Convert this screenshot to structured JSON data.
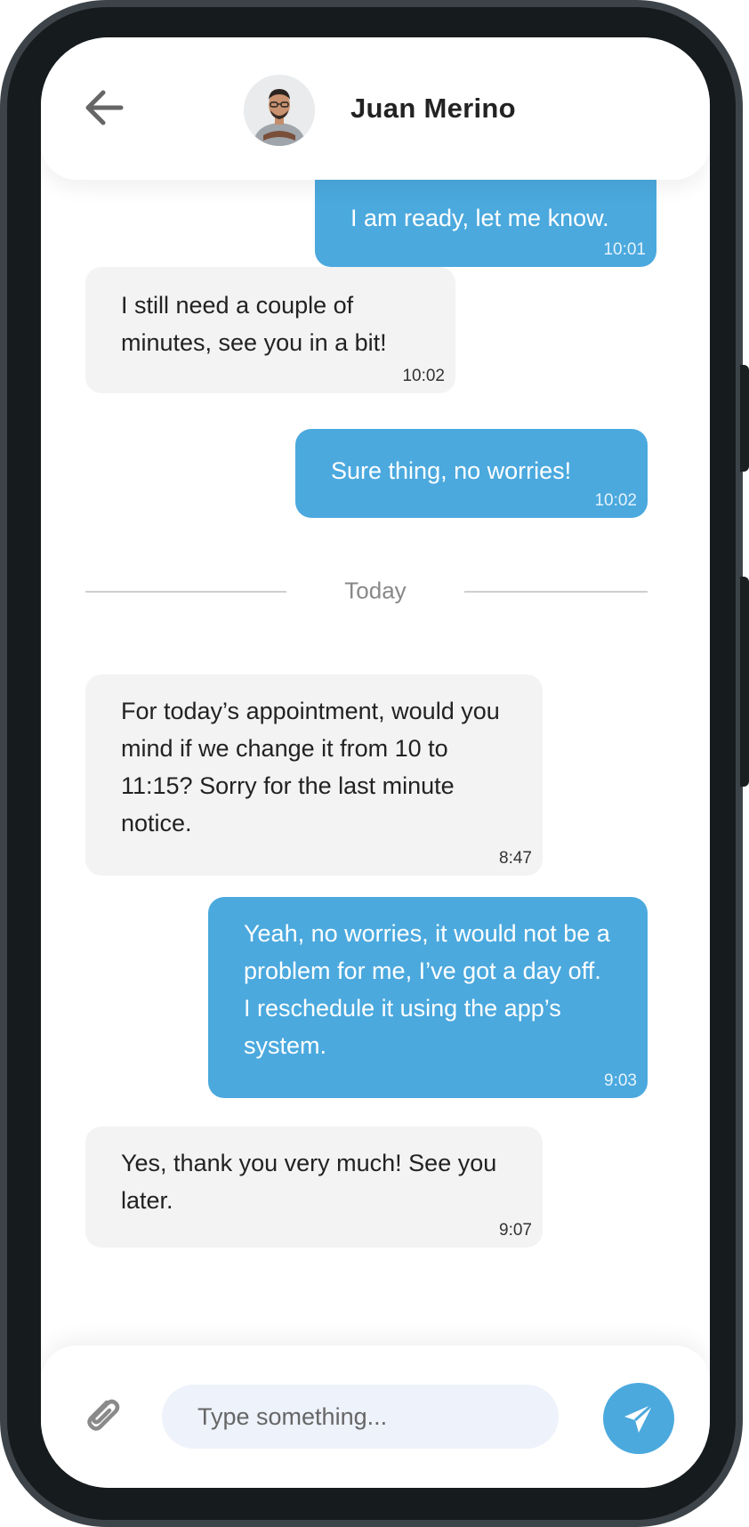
{
  "header": {
    "contact_name": "Juan Merino"
  },
  "messages": [
    {
      "side": "out",
      "text": "I am ready, let me know.",
      "time": "10:01"
    },
    {
      "side": "in",
      "text": "I still need a couple of minutes, see you in a bit!",
      "time": "10:02"
    },
    {
      "side": "out",
      "text": "Sure thing, no worries!",
      "time": "10:02"
    },
    {
      "side": "in",
      "text": "For today’s appointment, would you mind if we change it from 10 to 11:15? Sorry for the last minute notice.",
      "time": "8:47"
    },
    {
      "side": "out",
      "text": "Yeah, no worries, it would not be a problem for me, I’ve got a day off. I reschedule it using the app’s system.",
      "time": "9:03"
    },
    {
      "side": "in",
      "text": "Yes, thank you very much! See you later.",
      "time": "9:07"
    }
  ],
  "divider": {
    "label": "Today"
  },
  "composer": {
    "placeholder": "Type something..."
  },
  "colors": {
    "accent": "#4BA9DE",
    "incoming_bubble": "#F3F3F3",
    "input_bg": "#EEF2FA"
  }
}
